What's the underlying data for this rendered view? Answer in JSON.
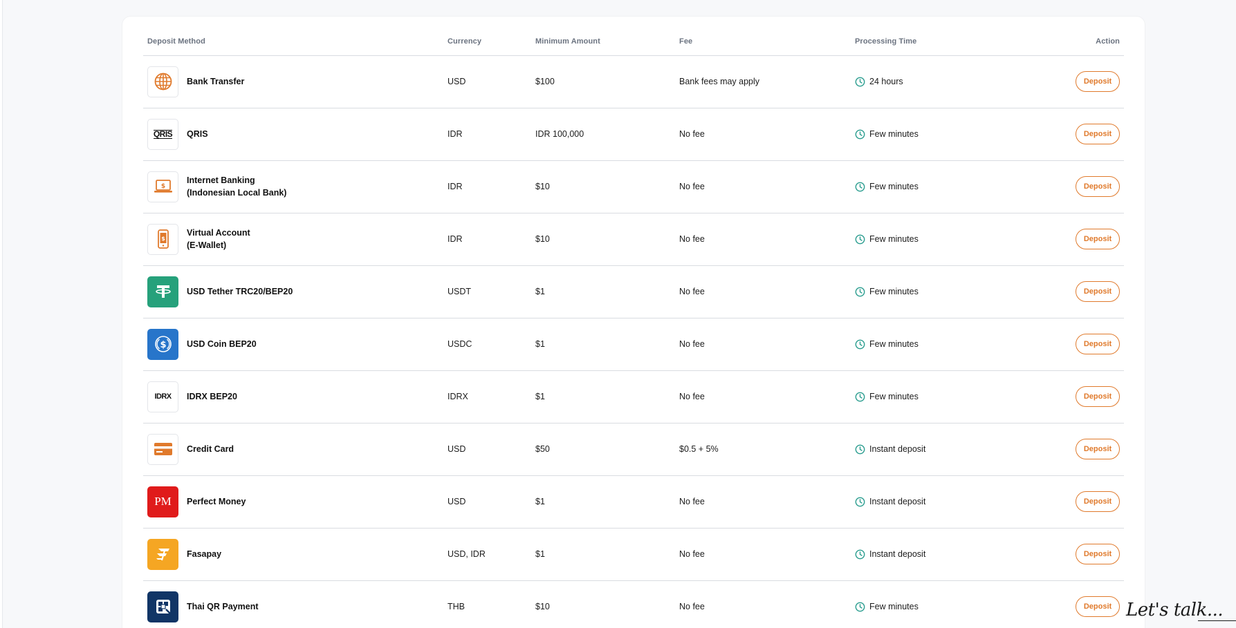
{
  "table": {
    "headers": {
      "method": "Deposit Method",
      "currency": "Currency",
      "minimum": "Minimum Amount",
      "fee": "Fee",
      "processing": "Processing Time",
      "action": "Action"
    },
    "rows": [
      {
        "name_lines": [
          "Bank Transfer"
        ],
        "currency": "USD",
        "minimum": "$100",
        "fee": "Bank fees may apply",
        "processing": "24 hours",
        "action": "Deposit",
        "icon": "globe-icon"
      },
      {
        "name_lines": [
          "QRIS"
        ],
        "currency": "IDR",
        "minimum": "IDR 100,000",
        "fee": "No fee",
        "processing": "Few minutes",
        "action": "Deposit",
        "icon": "qris-logo",
        "logo_text": "QRIS"
      },
      {
        "name_lines": [
          "Internet Banking",
          "(Indonesian Local Bank)"
        ],
        "currency": "IDR",
        "minimum": "$10",
        "fee": "No fee",
        "processing": "Few minutes",
        "action": "Deposit",
        "icon": "laptop-dollar-icon"
      },
      {
        "name_lines": [
          "Virtual Account",
          "(E-Wallet)"
        ],
        "currency": "IDR",
        "minimum": "$10",
        "fee": "No fee",
        "processing": "Few minutes",
        "action": "Deposit",
        "icon": "phone-dollar-icon"
      },
      {
        "name_lines": [
          "USD Tether TRC20/BEP20"
        ],
        "currency": "USDT",
        "minimum": "$1",
        "fee": "No fee",
        "processing": "Few minutes",
        "action": "Deposit",
        "icon": "tether-logo"
      },
      {
        "name_lines": [
          "USD Coin BEP20"
        ],
        "currency": "USDC",
        "minimum": "$1",
        "fee": "No fee",
        "processing": "Few minutes",
        "action": "Deposit",
        "icon": "usdc-logo"
      },
      {
        "name_lines": [
          "IDRX BEP20"
        ],
        "currency": "IDRX",
        "minimum": "$1",
        "fee": "No fee",
        "processing": "Few minutes",
        "action": "Deposit",
        "icon": "idrx-logo",
        "logo_text": "IDRX"
      },
      {
        "name_lines": [
          "Credit Card"
        ],
        "currency": "USD",
        "minimum": "$50",
        "fee": "$0.5 + 5%",
        "processing": "Instant deposit",
        "action": "Deposit",
        "icon": "credit-card-icon"
      },
      {
        "name_lines": [
          "Perfect Money"
        ],
        "currency": "USD",
        "minimum": "$1",
        "fee": "No fee",
        "processing": "Instant deposit",
        "action": "Deposit",
        "icon": "perfect-money-logo",
        "logo_text": "PM"
      },
      {
        "name_lines": [
          "Fasapay"
        ],
        "currency": "USD, IDR",
        "minimum": "$1",
        "fee": "No fee",
        "processing": "Instant deposit",
        "action": "Deposit",
        "icon": "fasapay-logo"
      },
      {
        "name_lines": [
          "Thai QR Payment"
        ],
        "currency": "THB",
        "minimum": "$10",
        "fee": "No fee",
        "processing": "Few minutes",
        "action": "Deposit",
        "icon": "thai-qr-logo"
      }
    ]
  },
  "chat_widget": {
    "label": "Let's talk..."
  },
  "colors": {
    "accent": "#e07a2c",
    "clock": "#2a9d8f",
    "tether": "#26a17b",
    "usdc": "#2775ca",
    "perfect_money": "#e01b1b",
    "fasapay": "#f5a623",
    "thai_qr": "#113566"
  }
}
